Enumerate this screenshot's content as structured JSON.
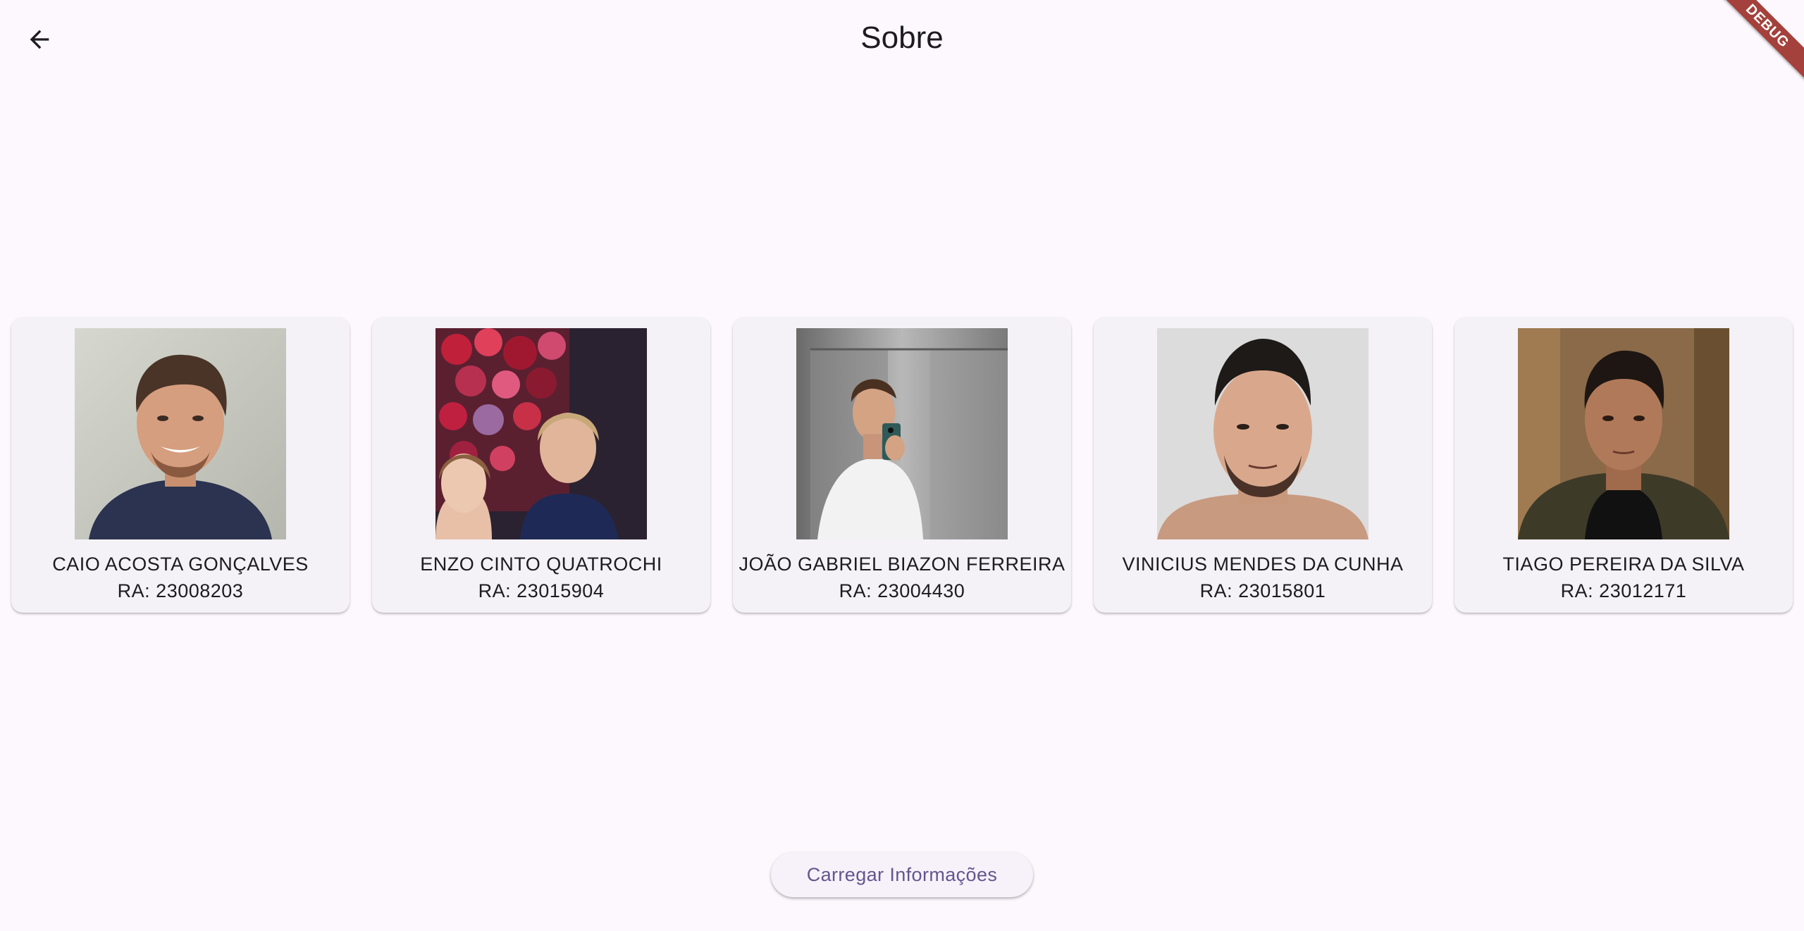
{
  "header": {
    "title": "Sobre",
    "back_icon": "arrow-back-icon"
  },
  "debug_banner": {
    "label": "DEBUG",
    "color": "#a4413c"
  },
  "members": [
    {
      "name": "CAIO ACOSTA GONÇALVES",
      "ra": "RA: 23008203"
    },
    {
      "name": "ENZO CINTO QUATROCHI",
      "ra": "RA: 23015904"
    },
    {
      "name": "JOÃO GABRIEL BIAZON FERREIRA",
      "ra": "RA: 23004430"
    },
    {
      "name": "VINICIUS MENDES DA CUNHA",
      "ra": "RA: 23015801"
    },
    {
      "name": "TIAGO PEREIRA DA SILVA",
      "ra": "RA: 23012171"
    }
  ],
  "footer": {
    "load_button_label": "Carregar Informações"
  },
  "colors": {
    "background": "#fdf8fd",
    "card": "#f4f1f7",
    "accent": "#65558f"
  }
}
